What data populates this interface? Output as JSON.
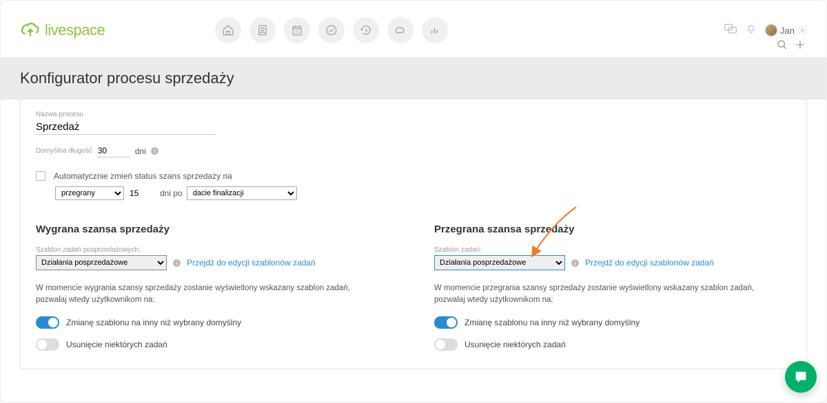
{
  "brand": "livespace",
  "user": {
    "name": "Jan"
  },
  "page_title": "Konfigurator procesu sprzedaży",
  "process": {
    "name_label": "Nazwa procesu",
    "name_value": "Sprzedaż",
    "default_len_label": "Domyślna długość",
    "default_len_value": "30",
    "days_unit": "dni",
    "auto_status_label": "Automatycznie zmień status szans sprzedaży na",
    "status_options": [
      "przegrany"
    ],
    "status_selected": "przegrany",
    "after_days_value": "15",
    "after_label": "dni po",
    "date_options": [
      "dacie finalizacji"
    ],
    "date_selected": "dacie finalizacji"
  },
  "won": {
    "heading": "Wygrana szansa sprzedaży",
    "template_label": "Szablon zadań posprzedażowych:",
    "template_selected": "Działania posprzedażowe",
    "edit_link": "Przejdź do edycji szablonów zadań",
    "description": "W momencie wygrania szansy sprzedaży zostanie wyświetlony wskazany szablon zadań, pozwalaj wtedy użytkownikom na:",
    "toggle1_label": "Zmianę szablonu na inny niż wybrany domyślny",
    "toggle1_on": true,
    "toggle2_label": "Usunięcie niektórych zadań",
    "toggle2_on": false
  },
  "lost": {
    "heading": "Przegrana szansa sprzedaży",
    "template_label": "Szablon zadań:",
    "template_selected": "Działania posprzedażowe",
    "edit_link": "Przejdź do edycji szablonów zadań",
    "description": "W momencie przegrania szansy sprzedaży zostanie wyświetlony wskazany szablon zadań, pozwalaj wtedy użytkownikom na:",
    "toggle1_label": "Zmianę szablonu na inny niż wybrany domyślny",
    "toggle1_on": true,
    "toggle2_label": "Usunięcie niektórych zadań",
    "toggle2_on": false
  },
  "colors": {
    "accent": "#2a8bd4",
    "brand": "#8bc63f",
    "arrow": "#f07d2e"
  }
}
